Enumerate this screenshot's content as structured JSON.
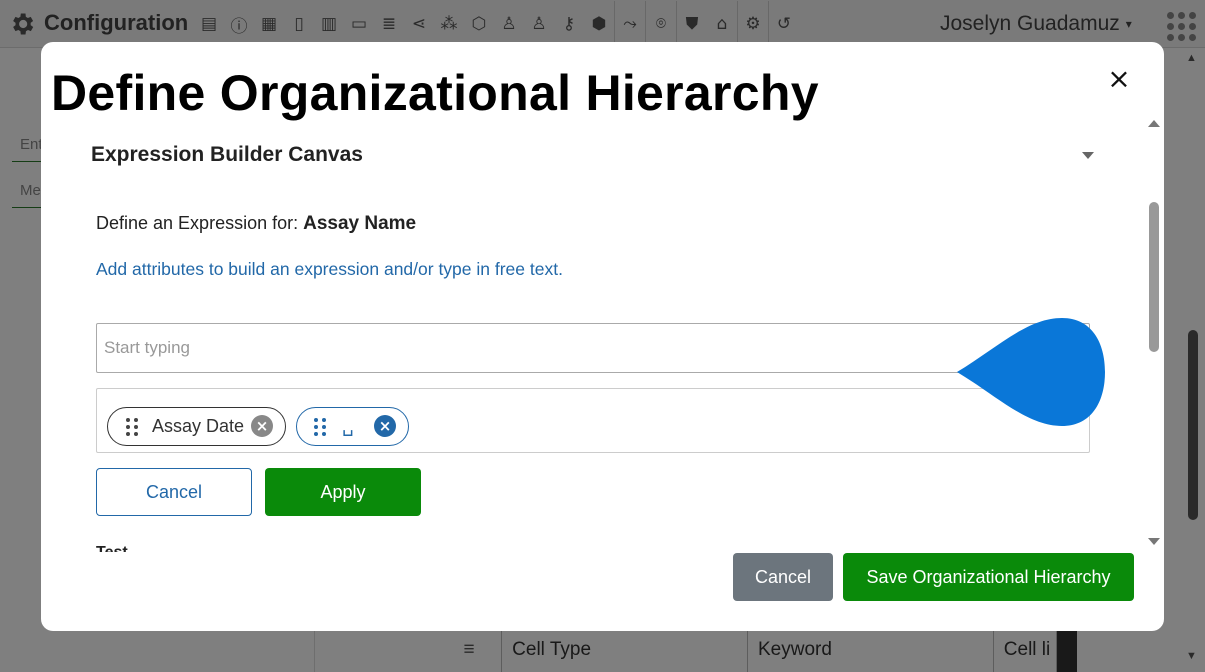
{
  "app": {
    "title": "Configuration",
    "user_name": "Joselyn Guadamuz",
    "toolbar_icons": [
      "grid-icon",
      "info-icon",
      "table-icon",
      "document-icon",
      "list-icon",
      "file-icon",
      "database-icon",
      "share-icon",
      "network-icon",
      "hexagon-icon",
      "users-icon",
      "user-icon",
      "key-icon",
      "cube-icon",
      "workflow-icon",
      "location-icon",
      "shield-icon",
      "factory-icon",
      "settings-icon",
      "history-icon"
    ]
  },
  "left_panel": {
    "field_1": "Ent",
    "field_2": "Me"
  },
  "background_table": {
    "row": [
      "Cell Type",
      "Keyword",
      "Cell li"
    ]
  },
  "modal": {
    "title": "Define Organizational Hierarchy",
    "close_label": "×",
    "section_title": "Expression Builder Canvas",
    "define_prefix": "Define an Expression for: ",
    "define_attribute": "Assay Name",
    "hint": "Add attributes to build an expression and/or type in free text.",
    "input": {
      "placeholder": "Start typing",
      "value": ""
    },
    "chips": [
      {
        "label": "Assay Date",
        "remove_icon": "close-circle-icon"
      },
      {
        "label": "␣",
        "remove_icon": "close-circle-icon"
      }
    ],
    "cancel_label": "Cancel",
    "apply_label": "Apply",
    "cut_off_label": "Test",
    "footer": {
      "cancel_label": "Cancel",
      "save_label": "Save Organizational Hierarchy"
    }
  },
  "colors": {
    "primary_green": "#0a8a0a",
    "link_blue": "#2268a8",
    "pointer_blue": "#0a77d8",
    "secondary_gray": "#6c757d"
  }
}
